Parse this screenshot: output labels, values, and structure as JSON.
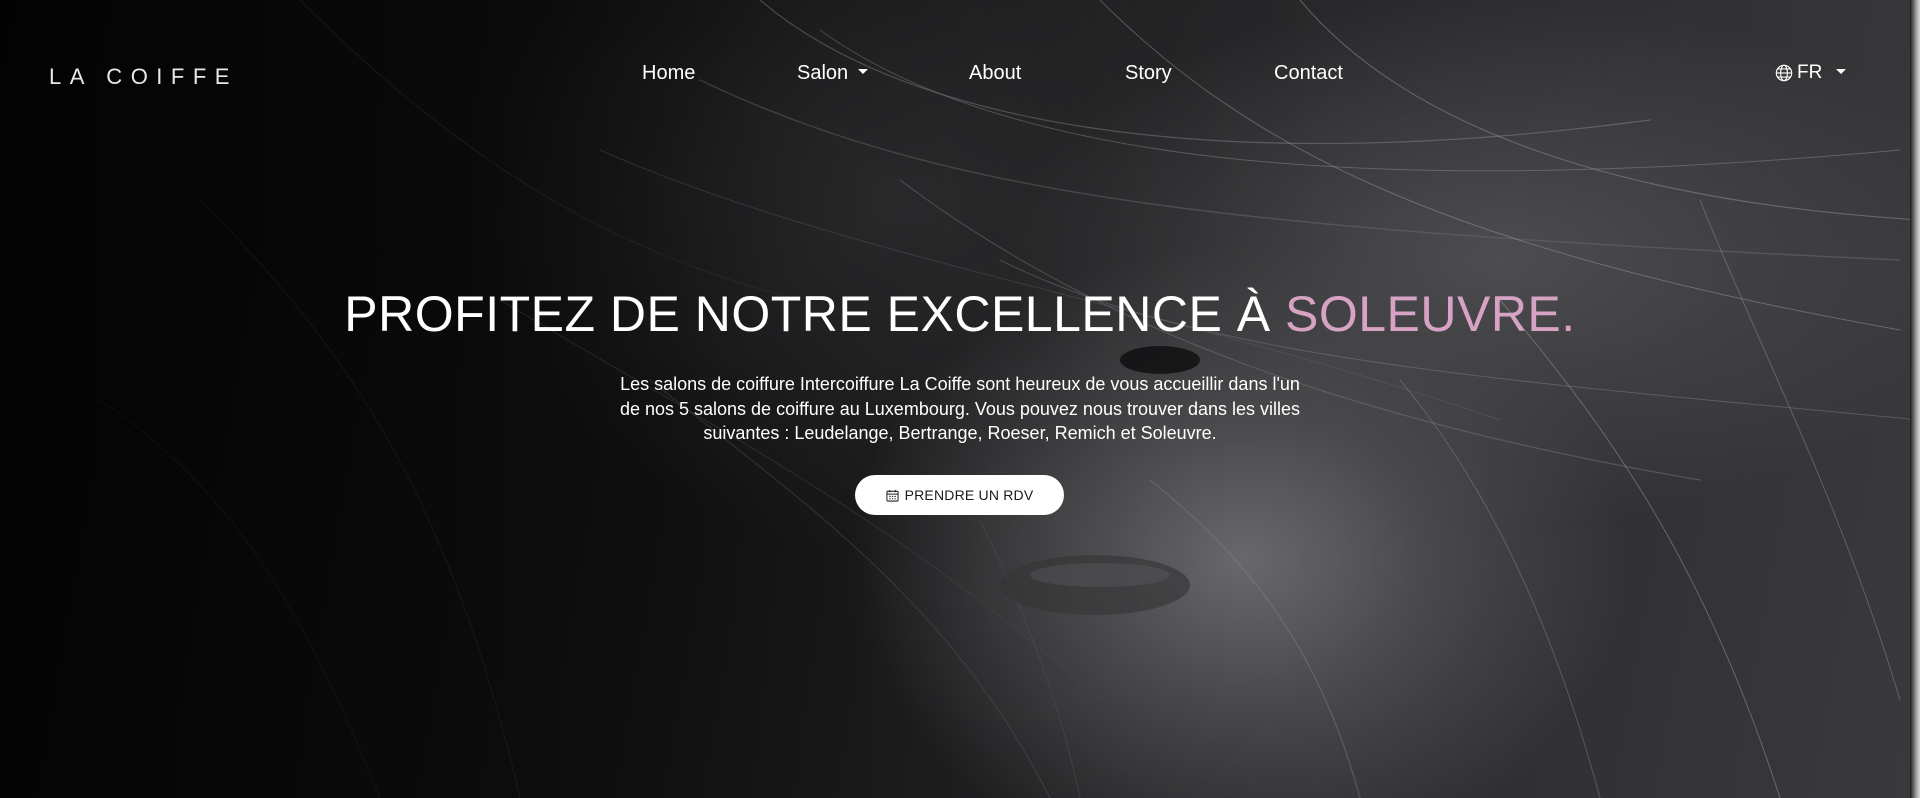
{
  "brand": {
    "logo_text": "LA COIFFE"
  },
  "nav": {
    "items": [
      {
        "label": "Home"
      },
      {
        "label": "Salon"
      },
      {
        "label": "About"
      },
      {
        "label": "Story"
      },
      {
        "label": "Contact"
      }
    ],
    "language": {
      "label": "FR",
      "icon": "globe-icon"
    }
  },
  "hero": {
    "headline_main": "PROFITEZ DE NOTRE EXCELLENCE À ",
    "headline_accent": "SOLEUVRE.",
    "intro": "Les salons de coiffure Intercoiffure La Coiffe sont heureux de vous accueillir dans l'un de nos 5 salons de coiffure au Luxembourg. Vous pouvez nous trouver dans les villes suivantes : Leudelange, Bertrange, Roeser, Remich et Soleuvre.",
    "cta_label": "PRENDRE UN RDV",
    "cta_icon": "calendar-icon"
  },
  "colors": {
    "accent": "#d6a3c4",
    "text": "#ffffff",
    "button_bg": "#ffffff",
    "button_text": "#1a1a1a"
  }
}
